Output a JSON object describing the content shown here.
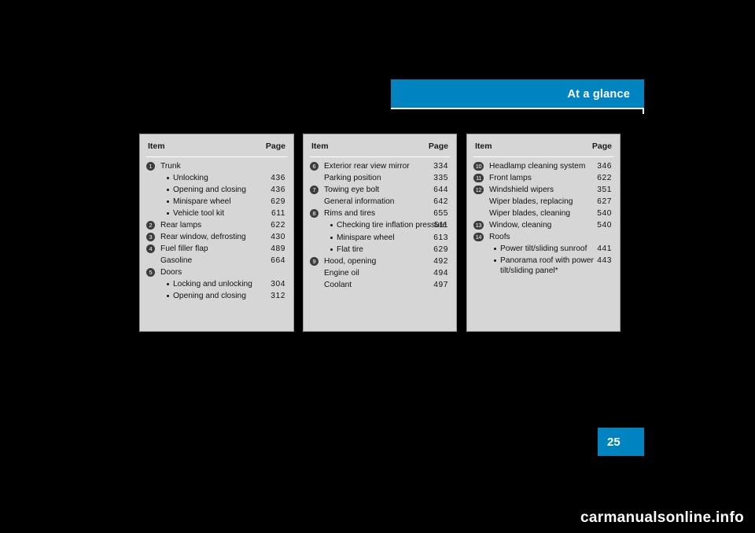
{
  "header": {
    "title": "At a glance"
  },
  "page_number": "25",
  "watermark": "carmanualsonline.info",
  "columns": [
    {
      "header": {
        "item": "Item",
        "page": "Page"
      },
      "rows": [
        {
          "type": "numbered",
          "marker": "1",
          "label": "Trunk",
          "page": ""
        },
        {
          "type": "bullet",
          "label": "Unlocking",
          "page": "436"
        },
        {
          "type": "bullet",
          "label": "Opening and closing",
          "page": "436"
        },
        {
          "type": "bullet",
          "label": "Minispare wheel",
          "page": "629"
        },
        {
          "type": "bullet",
          "label": "Vehicle tool kit",
          "page": "611"
        },
        {
          "type": "numbered",
          "marker": "2",
          "label": "Rear lamps",
          "page": "622"
        },
        {
          "type": "numbered",
          "marker": "3",
          "label": "Rear window, defrosting",
          "page": "430"
        },
        {
          "type": "numbered",
          "marker": "4",
          "label": "Fuel filler flap",
          "page": "489"
        },
        {
          "type": "plain",
          "label": "Gasoline",
          "page": "664"
        },
        {
          "type": "numbered",
          "marker": "5",
          "label": "Doors",
          "page": ""
        },
        {
          "type": "bullet",
          "label": "Locking and unlocking",
          "page": "304"
        },
        {
          "type": "bullet",
          "label": "Opening and closing",
          "page": "312"
        }
      ]
    },
    {
      "header": {
        "item": "Item",
        "page": "Page"
      },
      "rows": [
        {
          "type": "numbered",
          "marker": "6",
          "label": "Exterior rear view mirror",
          "page": "334"
        },
        {
          "type": "plain",
          "label": "Parking position",
          "page": "335"
        },
        {
          "type": "numbered",
          "marker": "7",
          "label": "Towing eye bolt",
          "page": "644"
        },
        {
          "type": "plain",
          "label": "General information",
          "page": "642"
        },
        {
          "type": "numbered",
          "marker": "8",
          "label": "Rims and tires",
          "page": "655"
        },
        {
          "type": "bullet",
          "label": "Checking tire inflation pressure",
          "page": "511",
          "two_line": true
        },
        {
          "type": "bullet",
          "label": "Minispare wheel",
          "page": "613"
        },
        {
          "type": "bullet",
          "label": "Flat tire",
          "page": "629"
        },
        {
          "type": "numbered",
          "marker": "9",
          "label": "Hood, opening",
          "page": "492"
        },
        {
          "type": "plain",
          "label": "Engine oil",
          "page": "494"
        },
        {
          "type": "plain",
          "label": "Coolant",
          "page": "497"
        }
      ]
    },
    {
      "header": {
        "item": "Item",
        "page": "Page"
      },
      "rows": [
        {
          "type": "numbered",
          "marker": "10",
          "wide": true,
          "label": "Headlamp cleaning system",
          "page": "346"
        },
        {
          "type": "numbered",
          "marker": "11",
          "wide": true,
          "label": "Front lamps",
          "page": "622"
        },
        {
          "type": "numbered",
          "marker": "12",
          "wide": true,
          "label": "Windshield wipers",
          "page": "351"
        },
        {
          "type": "plain",
          "wide": true,
          "label": "Wiper blades, replacing",
          "page": "627"
        },
        {
          "type": "plain",
          "wide": true,
          "label": "Wiper blades, cleaning",
          "page": "540"
        },
        {
          "type": "numbered",
          "marker": "13",
          "wide": true,
          "label": "Window, cleaning",
          "page": "540"
        },
        {
          "type": "numbered",
          "marker": "14",
          "wide": true,
          "label": "Roofs",
          "page": ""
        },
        {
          "type": "bullet",
          "label": "Power tilt/sliding sunroof",
          "page": "441"
        },
        {
          "type": "bullet",
          "label": "Panorama roof with power tilt/sliding panel*",
          "page": "443",
          "two_line": true
        }
      ]
    }
  ]
}
